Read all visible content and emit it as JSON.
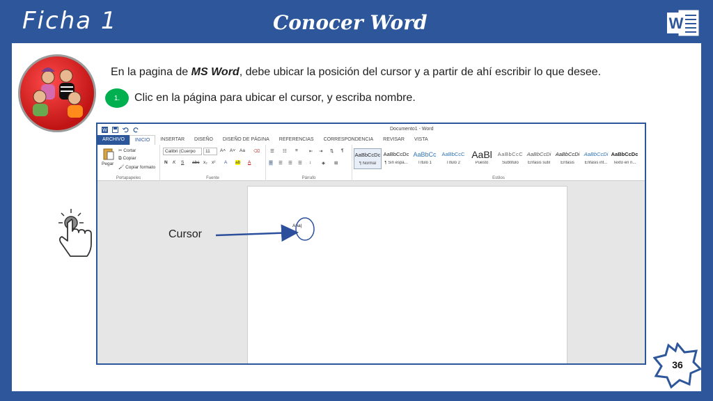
{
  "header": {
    "ficha": "Ficha 1",
    "title": "Conocer Word",
    "logo_letter": "W"
  },
  "intro": {
    "before": "En la pagina de ",
    "app": "MS Word",
    "after": ", debe ubicar la posición del cursor y a partir de ahí escribir lo que desee."
  },
  "step": {
    "number": "1.",
    "text": "Clic en la página para ubicar el cursor, y escriba nombre."
  },
  "word": {
    "window_title": "Documento1 - Word",
    "tabs": [
      "ARCHIVO",
      "INICIO",
      "INSERTAR",
      "DISEÑO",
      "DISEÑO DE PÁGINA",
      "REFERENCIAS",
      "CORRESPONDENCIA",
      "REVISAR",
      "VISTA"
    ],
    "clipboard": {
      "paste": "Pegar",
      "cut": "Cortar",
      "copy": "Copiar",
      "format_painter": "Copiar formato",
      "label": "Portapapeles"
    },
    "font": {
      "name": "Calibri (Cuerpo",
      "size": "11",
      "grow": "A˄",
      "shrink": "A˅",
      "case": "Aa",
      "bold": "N",
      "italic": "K",
      "underline": "S",
      "strike": "abc",
      "subscript": "x₂",
      "superscript": "x²",
      "label": "Fuente"
    },
    "paragraph": {
      "label": "Párrafo",
      "pilcrow": "¶"
    },
    "styles": {
      "label": "Estilos",
      "items": [
        {
          "sample": "AaBbCcDc",
          "name": "¶ Normal"
        },
        {
          "sample": "AaBbCcDc",
          "name": "¶ Sin espa..."
        },
        {
          "sample": "AaBbCc",
          "name": "Título 1"
        },
        {
          "sample": "AaBbCcC",
          "name": "Título 2"
        },
        {
          "sample": "AaBl",
          "name": "Puesto"
        },
        {
          "sample": "AaBbCcC",
          "name": "Subtítulo"
        },
        {
          "sample": "AaBbCcDi",
          "name": "Énfasis sutil"
        },
        {
          "sample": "AaBbCcDi",
          "name": "Énfasis"
        },
        {
          "sample": "AaBbCcDi",
          "name": "Énfasis int..."
        },
        {
          "sample": "AaBbCcDc",
          "name": "Texto en n..."
        }
      ]
    },
    "typed_text": "Ana|"
  },
  "annotation": {
    "cursor_label": "Cursor"
  },
  "page_number": "36",
  "colors": {
    "brand": "#2d579a",
    "panel": "#ffffff",
    "badge": "#00b050",
    "arrow": "#2b4f9a"
  }
}
